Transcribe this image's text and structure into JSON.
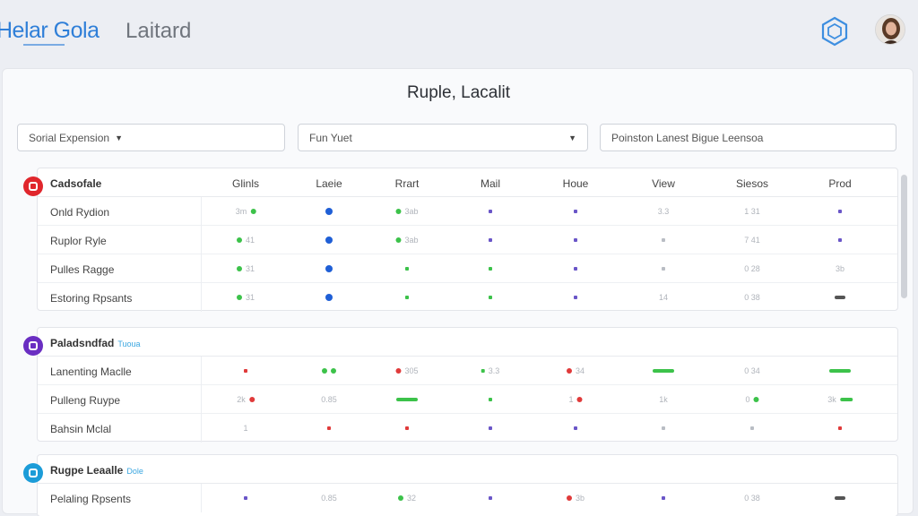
{
  "header": {
    "logo_text": "Helar Gola",
    "title": "Laitard",
    "settings_icon": "hexagon-icon",
    "avatar_icon": "user-avatar"
  },
  "panel": {
    "title": "Ruple, Lacalit",
    "filters": [
      {
        "label": "Sorial Expension",
        "has_caret": true
      },
      {
        "label": "Fun Yuet",
        "has_caret": true
      },
      {
        "label": "Poinston Lanest Bigue Leensoa",
        "has_caret": false
      }
    ]
  },
  "colors": {
    "green": "#3cc24a",
    "blue": "#1f5fd6",
    "purple": "#6a56c8",
    "red": "#e03a3a",
    "grey": "#b9bdc4",
    "dark": "#444444"
  },
  "columns": [
    {
      "label": "Glinls",
      "pos": 232
    },
    {
      "label": "Laeie",
      "pos": 325
    },
    {
      "label": "Rrart",
      "pos": 412
    },
    {
      "label": "Mail",
      "pos": 505
    },
    {
      "label": "Houe",
      "pos": 600
    },
    {
      "label": "View",
      "pos": 698
    },
    {
      "label": "Siesos",
      "pos": 797
    },
    {
      "label": "Prod",
      "pos": 895
    }
  ],
  "groups": [
    {
      "name": "Cadsofale",
      "badge": "",
      "icon_color": "#e0262c",
      "show_columns": true,
      "rows": [
        {
          "label": "Onld Rydion",
          "cells": [
            {
              "marks": [
                {
                  "t": "text",
                  "v": "3m"
                },
                {
                  "t": "dot",
                  "c": "green"
                }
              ]
            },
            {
              "marks": [
                {
                  "t": "bigdot",
                  "c": "blue"
                }
              ]
            },
            {
              "marks": [
                {
                  "t": "dot",
                  "c": "green"
                },
                {
                  "t": "text",
                  "v": "3ab"
                }
              ]
            },
            {
              "marks": [
                {
                  "t": "mini",
                  "c": "purple"
                }
              ]
            },
            {
              "marks": [
                {
                  "t": "mini",
                  "c": "purple"
                }
              ]
            },
            {
              "marks": [
                {
                  "t": "text",
                  "v": "3.3"
                }
              ]
            },
            {
              "marks": [
                {
                  "t": "text",
                  "v": "1 31"
                }
              ]
            },
            {
              "marks": [
                {
                  "t": "mini",
                  "c": "purple"
                }
              ]
            }
          ]
        },
        {
          "label": "Ruplor Ryle",
          "cells": [
            {
              "marks": [
                {
                  "t": "dot",
                  "c": "green"
                },
                {
                  "t": "text",
                  "v": "41"
                }
              ]
            },
            {
              "marks": [
                {
                  "t": "bigdot",
                  "c": "blue"
                }
              ]
            },
            {
              "marks": [
                {
                  "t": "dot",
                  "c": "green"
                },
                {
                  "t": "text",
                  "v": "3ab"
                }
              ]
            },
            {
              "marks": [
                {
                  "t": "mini",
                  "c": "purple"
                }
              ]
            },
            {
              "marks": [
                {
                  "t": "mini",
                  "c": "purple"
                }
              ]
            },
            {
              "marks": [
                {
                  "t": "mini",
                  "c": "grey"
                }
              ]
            },
            {
              "marks": [
                {
                  "t": "text",
                  "v": "7 41"
                }
              ]
            },
            {
              "marks": [
                {
                  "t": "mini",
                  "c": "purple"
                }
              ]
            }
          ]
        },
        {
          "label": "Pulles Ragge",
          "cells": [
            {
              "marks": [
                {
                  "t": "dot",
                  "c": "green"
                },
                {
                  "t": "text",
                  "v": "31"
                }
              ]
            },
            {
              "marks": [
                {
                  "t": "bigdot",
                  "c": "blue"
                }
              ]
            },
            {
              "marks": [
                {
                  "t": "mini",
                  "c": "green"
                }
              ]
            },
            {
              "marks": [
                {
                  "t": "mini",
                  "c": "green"
                }
              ]
            },
            {
              "marks": [
                {
                  "t": "mini",
                  "c": "purple"
                }
              ]
            },
            {
              "marks": [
                {
                  "t": "mini",
                  "c": "grey"
                }
              ]
            },
            {
              "marks": [
                {
                  "t": "text",
                  "v": "0 28"
                }
              ]
            },
            {
              "marks": [
                {
                  "t": "text",
                  "v": "3b"
                }
              ]
            }
          ]
        },
        {
          "label": "Estoring Rpsants",
          "cells": [
            {
              "marks": [
                {
                  "t": "dot",
                  "c": "green"
                },
                {
                  "t": "text",
                  "v": "31"
                }
              ]
            },
            {
              "marks": [
                {
                  "t": "bigdot",
                  "c": "blue"
                }
              ]
            },
            {
              "marks": [
                {
                  "t": "mini",
                  "c": "green"
                }
              ]
            },
            {
              "marks": [
                {
                  "t": "mini",
                  "c": "green"
                }
              ]
            },
            {
              "marks": [
                {
                  "t": "mini",
                  "c": "purple"
                }
              ]
            },
            {
              "marks": [
                {
                  "t": "text",
                  "v": "14"
                }
              ]
            },
            {
              "marks": [
                {
                  "t": "text",
                  "v": "0 38"
                }
              ]
            },
            {
              "marks": [
                {
                  "t": "tag"
                }
              ]
            }
          ]
        }
      ]
    },
    {
      "name": "Paladsndfad",
      "badge": "Tuoua",
      "icon_color": "#6a2ec2",
      "show_columns": false,
      "rows": [
        {
          "label": "Lanenting Maclle",
          "cells": [
            {
              "marks": [
                {
                  "t": "mini",
                  "c": "red"
                }
              ]
            },
            {
              "marks": [
                {
                  "t": "dot",
                  "c": "green"
                },
                {
                  "t": "dot",
                  "c": "green"
                }
              ]
            },
            {
              "marks": [
                {
                  "t": "dot",
                  "c": "red"
                },
                {
                  "t": "text",
                  "v": "305"
                }
              ]
            },
            {
              "marks": [
                {
                  "t": "mini",
                  "c": "green"
                },
                {
                  "t": "text",
                  "v": "3.3"
                }
              ]
            },
            {
              "marks": [
                {
                  "t": "dot",
                  "c": "red"
                },
                {
                  "t": "text",
                  "v": "34"
                }
              ]
            },
            {
              "marks": [
                {
                  "t": "bar",
                  "c": "green"
                }
              ]
            },
            {
              "marks": [
                {
                  "t": "text",
                  "v": "0 34"
                }
              ]
            },
            {
              "marks": [
                {
                  "t": "bar",
                  "c": "green"
                }
              ]
            }
          ]
        },
        {
          "label": "Pulleng Ruype",
          "cells": [
            {
              "marks": [
                {
                  "t": "text",
                  "v": "2k"
                },
                {
                  "t": "dot",
                  "c": "red"
                }
              ]
            },
            {
              "marks": [
                {
                  "t": "text",
                  "v": "0.85"
                }
              ]
            },
            {
              "marks": [
                {
                  "t": "bar",
                  "c": "green"
                }
              ]
            },
            {
              "marks": [
                {
                  "t": "mini",
                  "c": "green"
                }
              ]
            },
            {
              "marks": [
                {
                  "t": "text",
                  "v": "1"
                },
                {
                  "t": "dot",
                  "c": "red"
                }
              ]
            },
            {
              "marks": [
                {
                  "t": "text",
                  "v": "1k"
                }
              ]
            },
            {
              "marks": [
                {
                  "t": "text",
                  "v": "0"
                },
                {
                  "t": "dot",
                  "c": "green"
                }
              ]
            },
            {
              "marks": [
                {
                  "t": "text",
                  "v": "3k"
                },
                {
                  "t": "bar_short",
                  "c": "green"
                }
              ]
            }
          ]
        },
        {
          "label": "Bahsin Mclal",
          "cells": [
            {
              "marks": [
                {
                  "t": "text",
                  "v": "1"
                }
              ]
            },
            {
              "marks": [
                {
                  "t": "mini",
                  "c": "red"
                }
              ]
            },
            {
              "marks": [
                {
                  "t": "mini",
                  "c": "red"
                }
              ]
            },
            {
              "marks": [
                {
                  "t": "mini",
                  "c": "purple"
                }
              ]
            },
            {
              "marks": [
                {
                  "t": "mini",
                  "c": "purple"
                }
              ]
            },
            {
              "marks": [
                {
                  "t": "mini",
                  "c": "grey"
                }
              ]
            },
            {
              "marks": [
                {
                  "t": "mini",
                  "c": "grey"
                }
              ]
            },
            {
              "marks": [
                {
                  "t": "mini",
                  "c": "red"
                }
              ]
            }
          ]
        }
      ]
    },
    {
      "name": "Rugpe Leaalle",
      "badge": "Dole",
      "icon_color": "#1c9cd8",
      "show_columns": false,
      "rows": [
        {
          "label": "Pelaling Rpsents",
          "cells": [
            {
              "marks": [
                {
                  "t": "mini",
                  "c": "purple"
                }
              ]
            },
            {
              "marks": [
                {
                  "t": "text",
                  "v": "0.85"
                }
              ]
            },
            {
              "marks": [
                {
                  "t": "dot",
                  "c": "green"
                },
                {
                  "t": "text",
                  "v": "32"
                }
              ]
            },
            {
              "marks": [
                {
                  "t": "mini",
                  "c": "purple"
                }
              ]
            },
            {
              "marks": [
                {
                  "t": "dot",
                  "c": "red"
                },
                {
                  "t": "text",
                  "v": "3b"
                }
              ]
            },
            {
              "marks": [
                {
                  "t": "mini",
                  "c": "purple"
                }
              ]
            },
            {
              "marks": [
                {
                  "t": "text",
                  "v": "0 38"
                }
              ]
            },
            {
              "marks": [
                {
                  "t": "tag"
                }
              ]
            }
          ]
        }
      ]
    }
  ]
}
